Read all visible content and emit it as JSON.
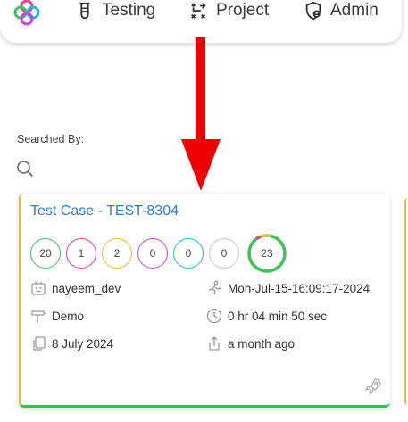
{
  "nav": {
    "logo_icon": "app-logo-icon",
    "items": [
      {
        "label": "Testing",
        "icon": "test-tube-icon"
      },
      {
        "label": "Project",
        "icon": "project-flow-icon"
      },
      {
        "label": "Admin",
        "icon": "admin-shield-icon"
      }
    ]
  },
  "search": {
    "label": "Searched By:",
    "icon": "search-icon"
  },
  "card": {
    "title": "Test Case - TEST-8304",
    "counts": [
      {
        "value": "20",
        "color": "#3cc35a"
      },
      {
        "value": "1",
        "color": "#e8408a"
      },
      {
        "value": "2",
        "color": "#f2b73d"
      },
      {
        "value": "0",
        "color": "#c944d8"
      },
      {
        "value": "0",
        "color": "#22b8de"
      },
      {
        "value": "0",
        "color": "#c8c8c8"
      }
    ],
    "total": "23",
    "author": "nayeem_dev",
    "executed_at": "Mon-Jul-15-16:09:17-2024",
    "environment": "Demo",
    "duration": "0 hr 04 min 50 sec",
    "created_date": "8 July 2024",
    "relative_time": "a month ago"
  },
  "colors": {
    "accent_blue": "#2a7bd3",
    "success_green": "#35c34f",
    "warning_yellow": "#f4b63a",
    "annotation_red": "#ee0000"
  }
}
